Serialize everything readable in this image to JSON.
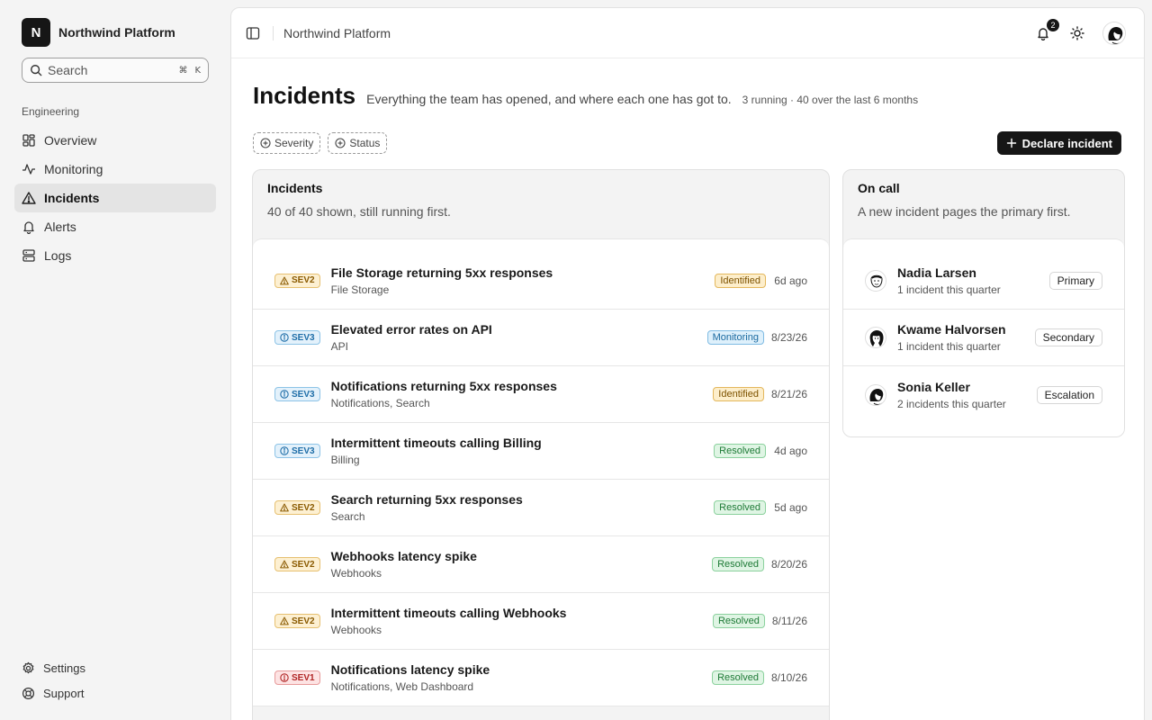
{
  "brand": {
    "logo_letter": "N",
    "name": "Northwind Platform"
  },
  "search": {
    "placeholder": "Search",
    "shortcut_mod": "⌘",
    "shortcut_key": "K"
  },
  "sidebar": {
    "section": "Engineering",
    "items": [
      {
        "label": "Overview",
        "icon": "dashboard-icon"
      },
      {
        "label": "Monitoring",
        "icon": "activity-icon"
      },
      {
        "label": "Incidents",
        "icon": "warning-triangle-icon",
        "active": true
      },
      {
        "label": "Alerts",
        "icon": "bell-icon"
      },
      {
        "label": "Logs",
        "icon": "server-stack-icon"
      }
    ],
    "bottom": [
      {
        "label": "Settings",
        "icon": "gear-icon"
      },
      {
        "label": "Support",
        "icon": "lifebuoy-icon"
      }
    ]
  },
  "topbar": {
    "title": "Northwind Platform",
    "notification_count": "2"
  },
  "page": {
    "title": "Incidents",
    "subtitle": "Everything the team has opened, and where each one has got to.",
    "meta": "3 running · 40 over the last 6 months"
  },
  "filters": {
    "severity": "Severity",
    "status": "Status"
  },
  "actions": {
    "declare": "Declare incident"
  },
  "incidents_card": {
    "title": "Incidents",
    "subtitle": "40 of 40 shown, still running first.",
    "rows": [
      {
        "sev": "SEV2",
        "title": "File Storage returning 5xx responses",
        "service": "File Storage",
        "status": "Identified",
        "time": "6d ago"
      },
      {
        "sev": "SEV3",
        "title": "Elevated error rates on API",
        "service": "API",
        "status": "Monitoring",
        "time": "8/23/26"
      },
      {
        "sev": "SEV3",
        "title": "Notifications returning 5xx responses",
        "service": "Notifications, Search",
        "status": "Identified",
        "time": "8/21/26"
      },
      {
        "sev": "SEV3",
        "title": "Intermittent timeouts calling Billing",
        "service": "Billing",
        "status": "Resolved",
        "time": "4d ago"
      },
      {
        "sev": "SEV2",
        "title": "Search returning 5xx responses",
        "service": "Search",
        "status": "Resolved",
        "time": "5d ago"
      },
      {
        "sev": "SEV2",
        "title": "Webhooks latency spike",
        "service": "Webhooks",
        "status": "Resolved",
        "time": "8/20/26"
      },
      {
        "sev": "SEV2",
        "title": "Intermittent timeouts calling Webhooks",
        "service": "Webhooks",
        "status": "Resolved",
        "time": "8/11/26"
      },
      {
        "sev": "SEV1",
        "title": "Notifications latency spike",
        "service": "Notifications, Web Dashboard",
        "status": "Resolved",
        "time": "8/10/26"
      }
    ]
  },
  "oncall_card": {
    "title": "On call",
    "subtitle": "A new incident pages the primary first.",
    "people": [
      {
        "name": "Nadia Larsen",
        "count": "1 incident this quarter",
        "role": "Primary"
      },
      {
        "name": "Kwame Halvorsen",
        "count": "1 incident this quarter",
        "role": "Secondary"
      },
      {
        "name": "Sonia Keller",
        "count": "2 incidents this quarter",
        "role": "Escalation"
      }
    ]
  }
}
